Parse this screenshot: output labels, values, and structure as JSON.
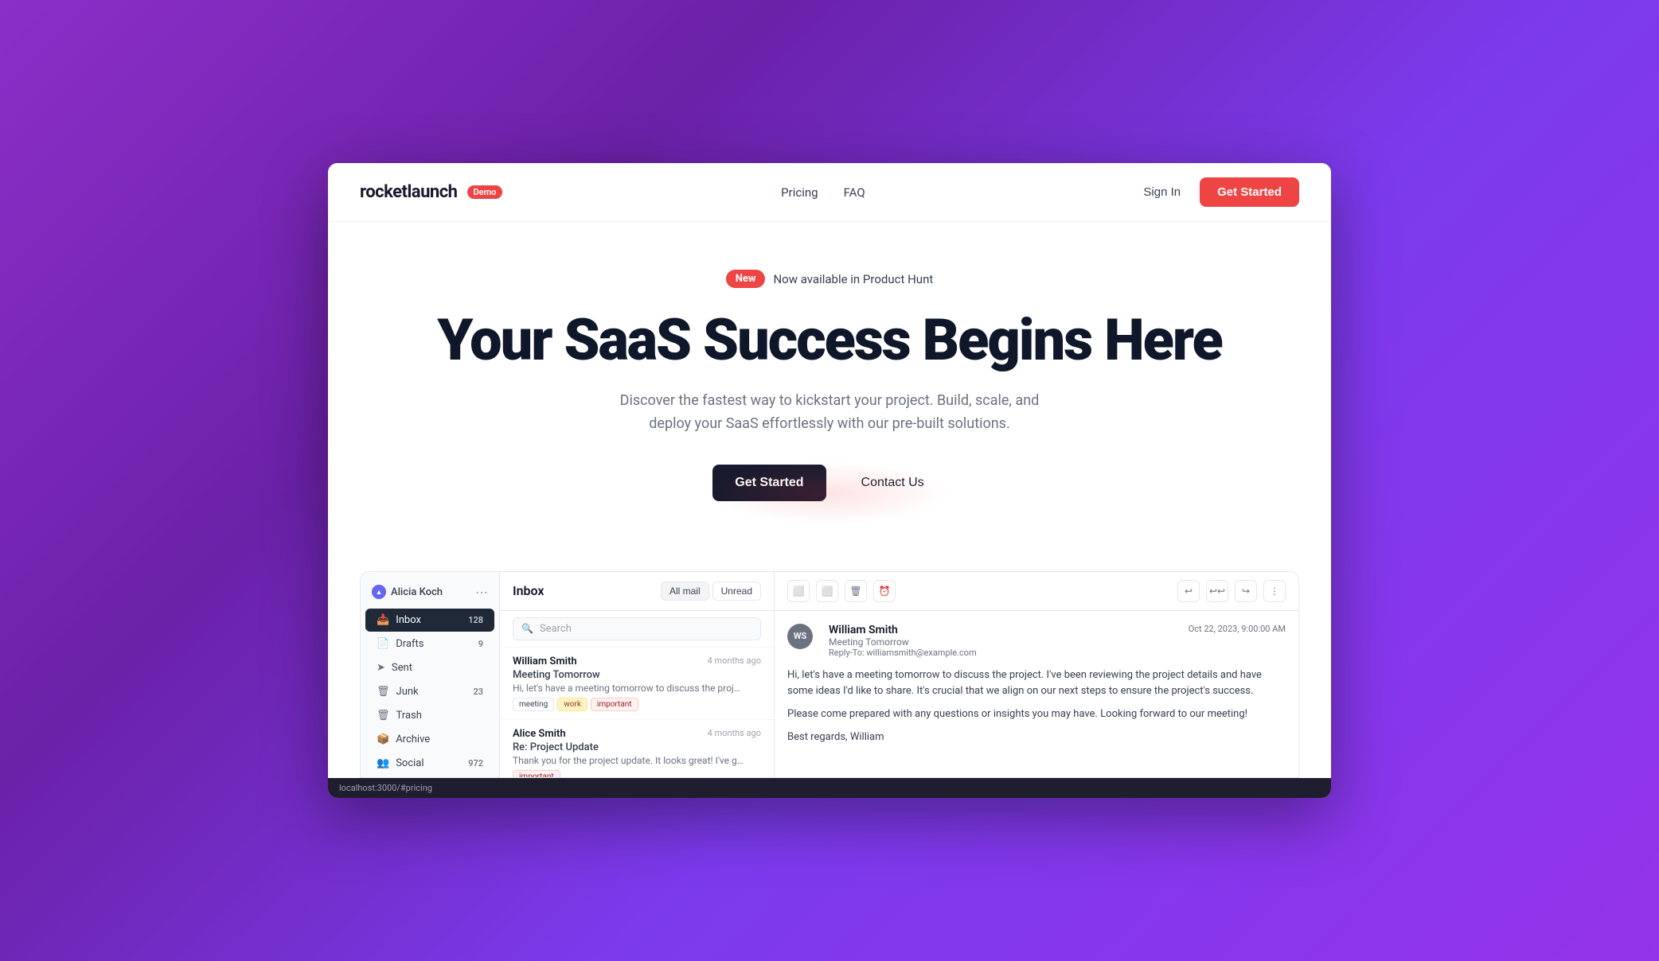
{
  "nav": {
    "logo": "rocketlaunch",
    "demo_badge": "Demo",
    "links": [
      "Pricing",
      "FAQ"
    ],
    "sign_in": "Sign In",
    "get_started": "Get Started"
  },
  "hero": {
    "new_badge": "New",
    "product_hunt_text": "Now available in Product Hunt",
    "title": "Your SaaS Success Begins Here",
    "subtitle": "Discover the fastest way to kickstart your project. Build, scale, and deploy your SaaS effortlessly with our pre-built solutions.",
    "get_started_btn": "Get Started",
    "contact_us_btn": "Contact Us"
  },
  "email_app": {
    "sidebar": {
      "user": "Alicia Koch",
      "items": [
        {
          "label": "Inbox",
          "count": "128",
          "active": true
        },
        {
          "label": "Drafts",
          "count": "9",
          "active": false
        },
        {
          "label": "Sent",
          "count": "",
          "active": false
        },
        {
          "label": "Junk",
          "count": "23",
          "active": false
        },
        {
          "label": "Trash",
          "count": "",
          "active": false
        },
        {
          "label": "Archive",
          "count": "",
          "active": false
        },
        {
          "label": "Social",
          "count": "972",
          "active": false
        }
      ]
    },
    "list": {
      "title": "Inbox",
      "filter_all": "All mail",
      "filter_unread": "Unread",
      "search_placeholder": "Search",
      "emails": [
        {
          "sender": "William Smith",
          "time": "4 months ago",
          "subject": "Meeting Tomorrow",
          "preview": "Hi, let's have a meeting tomorrow to discuss the project. I've been reviewing the project details and have some ideas I'd like to share. It's crucial that we align on our next step...",
          "tags": [
            "meeting",
            "work",
            "important"
          ]
        },
        {
          "sender": "Alice Smith",
          "time": "4 months ago",
          "subject": "Re: Project Update",
          "preview": "Thank you for the project update. It looks great! I've gone through the report, and the progress is impressive. The team has done a fantastic job, and...",
          "tags": [
            "important"
          ]
        }
      ]
    },
    "detail": {
      "sender_initials": "WS",
      "sender_name": "William Smith",
      "subject": "Meeting Tomorrow",
      "date": "Oct 22, 2023, 9:00:00 AM",
      "reply_to": "Reply-To: williamsmith@example.com",
      "body_p1": "Hi, let's have a meeting tomorrow to discuss the project. I've been reviewing the project details and have some ideas I'd like to share. It's crucial that we align on our next steps to ensure the project's success.",
      "body_p2": "Please come prepared with any questions or insights you may have. Looking forward to our meeting!",
      "body_p3": "Best regards, William"
    }
  },
  "bottom_bar": {
    "url": "localhost:3000/#pricing"
  }
}
